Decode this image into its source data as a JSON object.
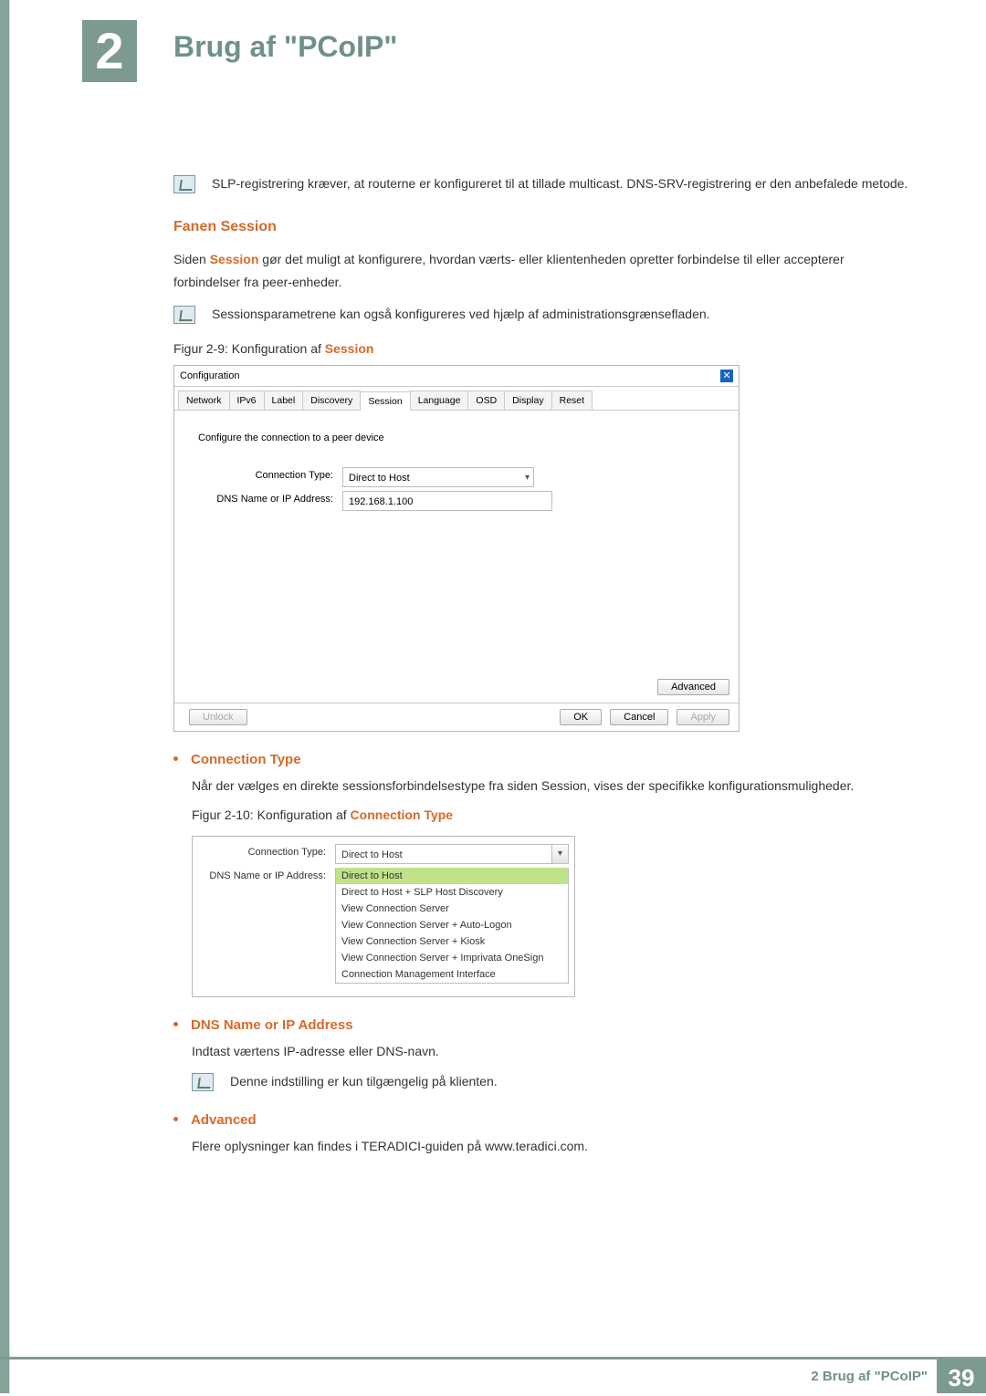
{
  "chapter": {
    "number": "2",
    "title": "Brug af \"PCoIP\""
  },
  "intro_note": "SLP-registrering kræver, at routerne er konfigureret til at tillade multicast. DNS-SRV-registrering er den anbefalede metode.",
  "section": {
    "heading": "Fanen Session",
    "p1_pre": "Siden ",
    "p1_strong": "Session",
    "p1_post": " gør det muligt at konfigurere, hvordan værts- eller klientenheden opretter forbindelse til eller accepterer forbindelser fra peer-enheder.",
    "note2": "Sessionsparametrene kan også konfigureres ved hjælp af administrationsgrænsefladen.",
    "fig29_pre": "Figur 2-9: Konfiguration af ",
    "fig29_strong": "Session"
  },
  "config_window": {
    "title": "Configuration",
    "close": "✕",
    "tabs": [
      "Network",
      "IPv6",
      "Label",
      "Discovery",
      "Session",
      "Language",
      "OSD",
      "Display",
      "Reset"
    ],
    "active_tab_index": 4,
    "instruction": "Configure the connection to a peer device",
    "fields": {
      "conn_type_label": "Connection Type:",
      "conn_type_value": "Direct to Host",
      "dns_label": "DNS Name or IP Address:",
      "dns_value": "192.168.1.100"
    },
    "buttons": {
      "advanced": "Advanced",
      "unlock": "Unlock",
      "ok": "OK",
      "cancel": "Cancel",
      "apply": "Apply"
    }
  },
  "bullets": {
    "conn_type": {
      "title": "Connection Type",
      "text": "Når der vælges en direkte sessionsforbindelsestype fra siden Session, vises der specifikke konfigurationsmuligheder.",
      "fig_pre": "Figur 2-10: Konfiguration af ",
      "fig_strong": "Connection Type"
    },
    "fig210": {
      "conn_type_label": "Connection Type:",
      "conn_type_value": "Direct to Host",
      "dns_label": "DNS Name or IP Address:",
      "options": [
        "Direct to Host",
        "Direct to Host + SLP Host Discovery",
        "View Connection Server",
        "View Connection Server + Auto-Logon",
        "View Connection Server + Kiosk",
        "View Connection Server + Imprivata OneSign",
        "Connection Management Interface"
      ],
      "selected_index": 0
    },
    "dns": {
      "title": "DNS Name or IP Address",
      "text": "Indtast værtens IP-adresse eller DNS-navn.",
      "note": "Denne indstilling er kun tilgængelig på klienten."
    },
    "advanced": {
      "title": "Advanced",
      "text": "Flere oplysninger kan findes i TERADICI-guiden på www.teradici.com."
    }
  },
  "footer": {
    "label": "2 Brug af \"PCoIP\"",
    "page": "39"
  }
}
